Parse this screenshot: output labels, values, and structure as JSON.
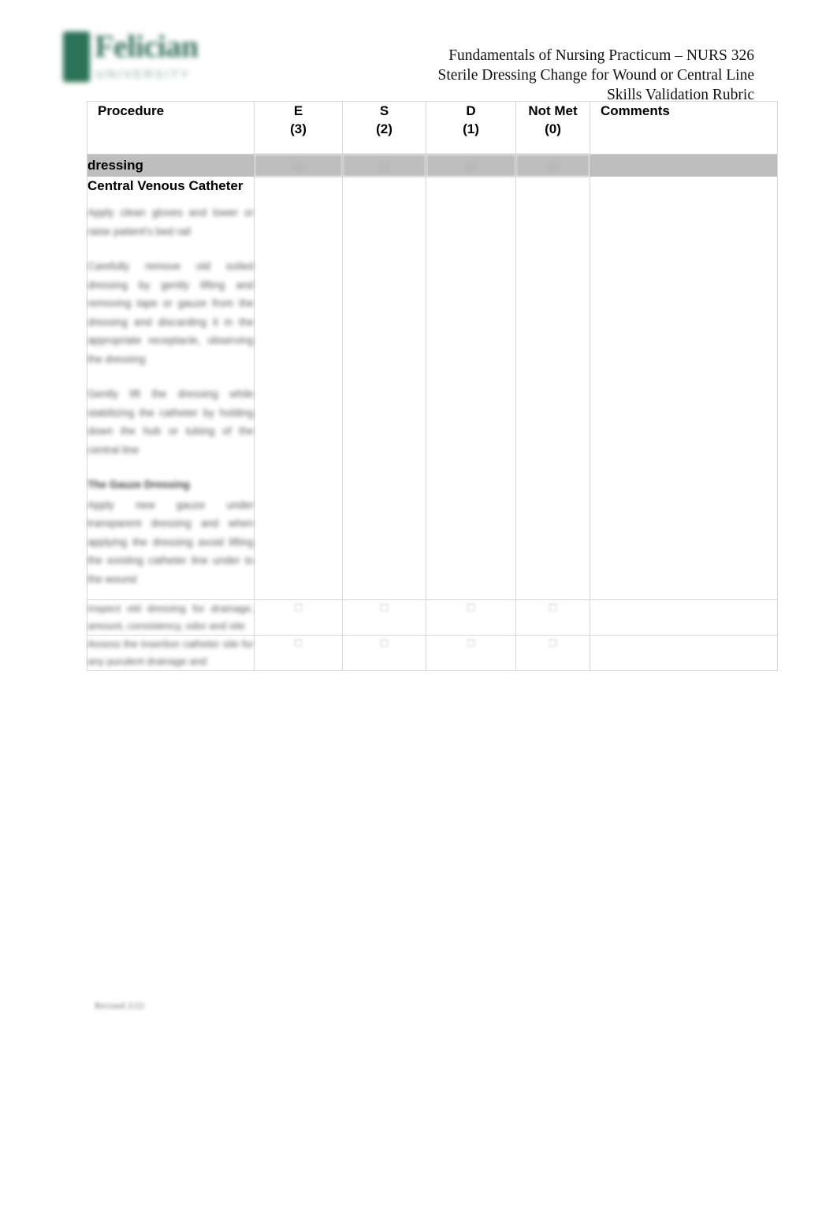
{
  "document": {
    "logo": {
      "wordmark": "Felician",
      "subtitle": "UNIVERSITY",
      "color": "#1f6b50"
    },
    "header": {
      "line1": "Fundamentals of Nursing Practicum – NURS 326",
      "line2": "Sterile Dressing Change for Wound or Central Line",
      "line3": "Skills Validation Rubric"
    },
    "footer": {
      "note": "Revised 2/22"
    }
  },
  "table": {
    "columns": [
      {
        "label": "Procedure",
        "sub": ""
      },
      {
        "label": "E",
        "sub": "(3)"
      },
      {
        "label": "S",
        "sub": "(2)"
      },
      {
        "label": "D",
        "sub": "(1)"
      },
      {
        "label": "Not Met",
        "sub": "(0)"
      },
      {
        "label": "Comments",
        "sub": ""
      }
    ],
    "band_row": {
      "label": "dressing",
      "marks": [
        "□",
        "□",
        "□",
        "□"
      ]
    },
    "rows": [
      {
        "section_title": "Central Venous Catheter",
        "paragraphs": [
          "Apply clean gloves and lower or raise patient's bed rail",
          "Carefully remove old soiled dressing by gently lifting and removing tape or gauze from the dressing and discarding it in the appropriate receptacle, observing the dressing",
          "Gently lift the dressing while stabilizing the catheter by holding down the hub or tubing of the central line",
          "",
          "The Gauze Dressing",
          "Apply new gauze under transparent dressing and when applying the dressing avoid lifting the existing catheter line under to the wound"
        ],
        "bold_head_index": 4,
        "marks": [
          "",
          "",
          "",
          ""
        ]
      },
      {
        "section_title": "",
        "paragraphs": [
          "Inspect old dressing for drainage, amount, consistency, odor and site"
        ],
        "bold_head_index": -1,
        "marks": [
          "□",
          "□",
          "□",
          "□"
        ]
      },
      {
        "section_title": "",
        "paragraphs": [
          "Assess the insertion catheter site for any purulent drainage and"
        ],
        "bold_head_index": -1,
        "marks": [
          "□",
          "□",
          "□",
          "□"
        ]
      }
    ]
  }
}
